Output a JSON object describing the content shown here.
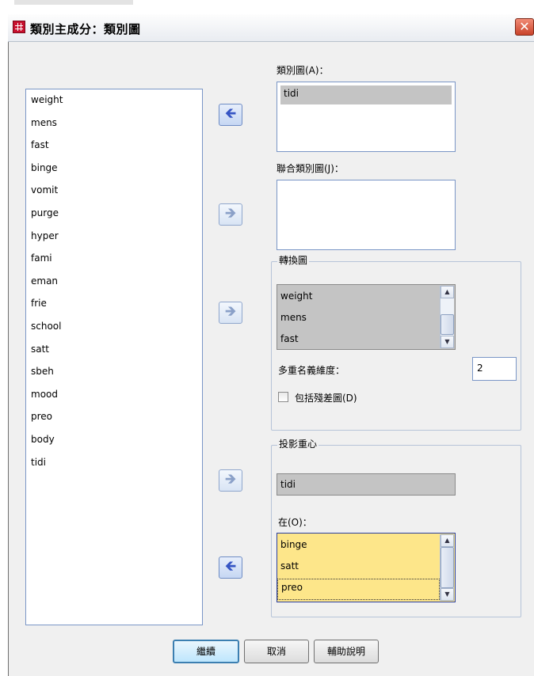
{
  "window": {
    "title": "類別主成分：類別圖"
  },
  "variables": [
    "weight",
    "mens",
    "fast",
    "binge",
    "vomit",
    "purge",
    "hyper",
    "fami",
    "eman",
    "frie",
    "school",
    "satt",
    "sbeh",
    "mood",
    "preo",
    "body",
    "tidi"
  ],
  "category_plots": {
    "label": "類別圖(A)：",
    "items": [
      "tidi"
    ]
  },
  "joint_category_plots": {
    "label": "聯合類別圖(J)：",
    "items": []
  },
  "transformation_plots": {
    "group_title": "轉換圖",
    "items": [
      "weight",
      "mens",
      "fast"
    ],
    "dimensions_label": "多重名義維度：",
    "dimensions_value": "2",
    "include_residuals_label": "包括殘差圖(D)"
  },
  "project_centroids": {
    "group_title": "投影重心",
    "selected": "tidi",
    "onto_label": "在(O)：",
    "onto_items": [
      "binge",
      "satt",
      "preo"
    ]
  },
  "buttons": {
    "continue": "繼續",
    "cancel": "取消",
    "help": "輔助說明"
  }
}
